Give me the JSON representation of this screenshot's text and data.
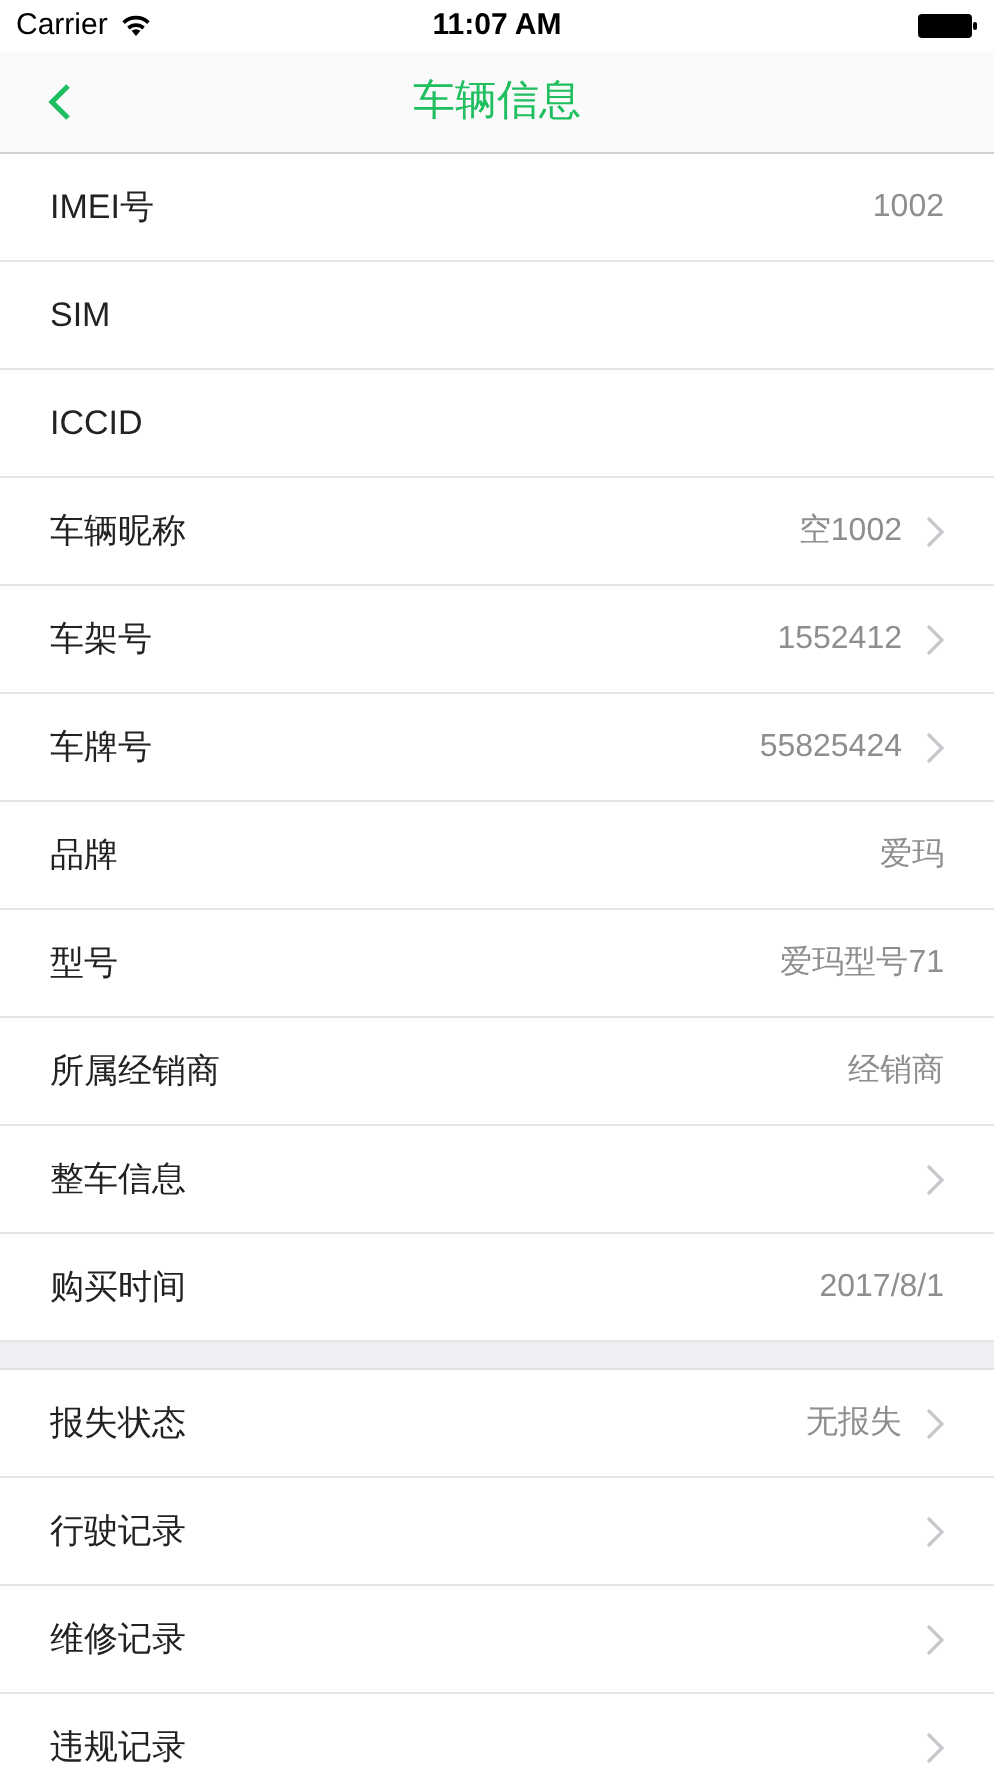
{
  "status_bar": {
    "carrier": "Carrier",
    "time": "11:07 AM"
  },
  "nav": {
    "title": "车辆信息"
  },
  "groups": [
    {
      "rows": [
        {
          "label": "IMEI号",
          "value": "1002",
          "chevron": false
        },
        {
          "label": "SIM",
          "chevron": false
        },
        {
          "label": "ICCID",
          "chevron": false
        },
        {
          "label": "车辆昵称",
          "value": "空1002",
          "chevron": true
        },
        {
          "label": "车架号",
          "value": "1552412",
          "chevron": true
        },
        {
          "label": "车牌号",
          "value": "55825424",
          "chevron": true
        },
        {
          "label": "品牌",
          "value": "爱玛",
          "chevron": false
        },
        {
          "label": "型号",
          "value": "爱玛型号71",
          "chevron": false
        },
        {
          "label": "所属经销商",
          "value": "经销商",
          "chevron": false
        },
        {
          "label": "整车信息",
          "chevron": true
        },
        {
          "label": "购买时间",
          "value": "2017/8/1",
          "chevron": false
        }
      ]
    },
    {
      "rows": [
        {
          "label": "报失状态",
          "value": "无报失",
          "chevron": true
        },
        {
          "label": "行驶记录",
          "chevron": true
        },
        {
          "label": "维修记录",
          "chevron": true
        },
        {
          "label": "违规记录",
          "chevron": true
        }
      ]
    }
  ]
}
